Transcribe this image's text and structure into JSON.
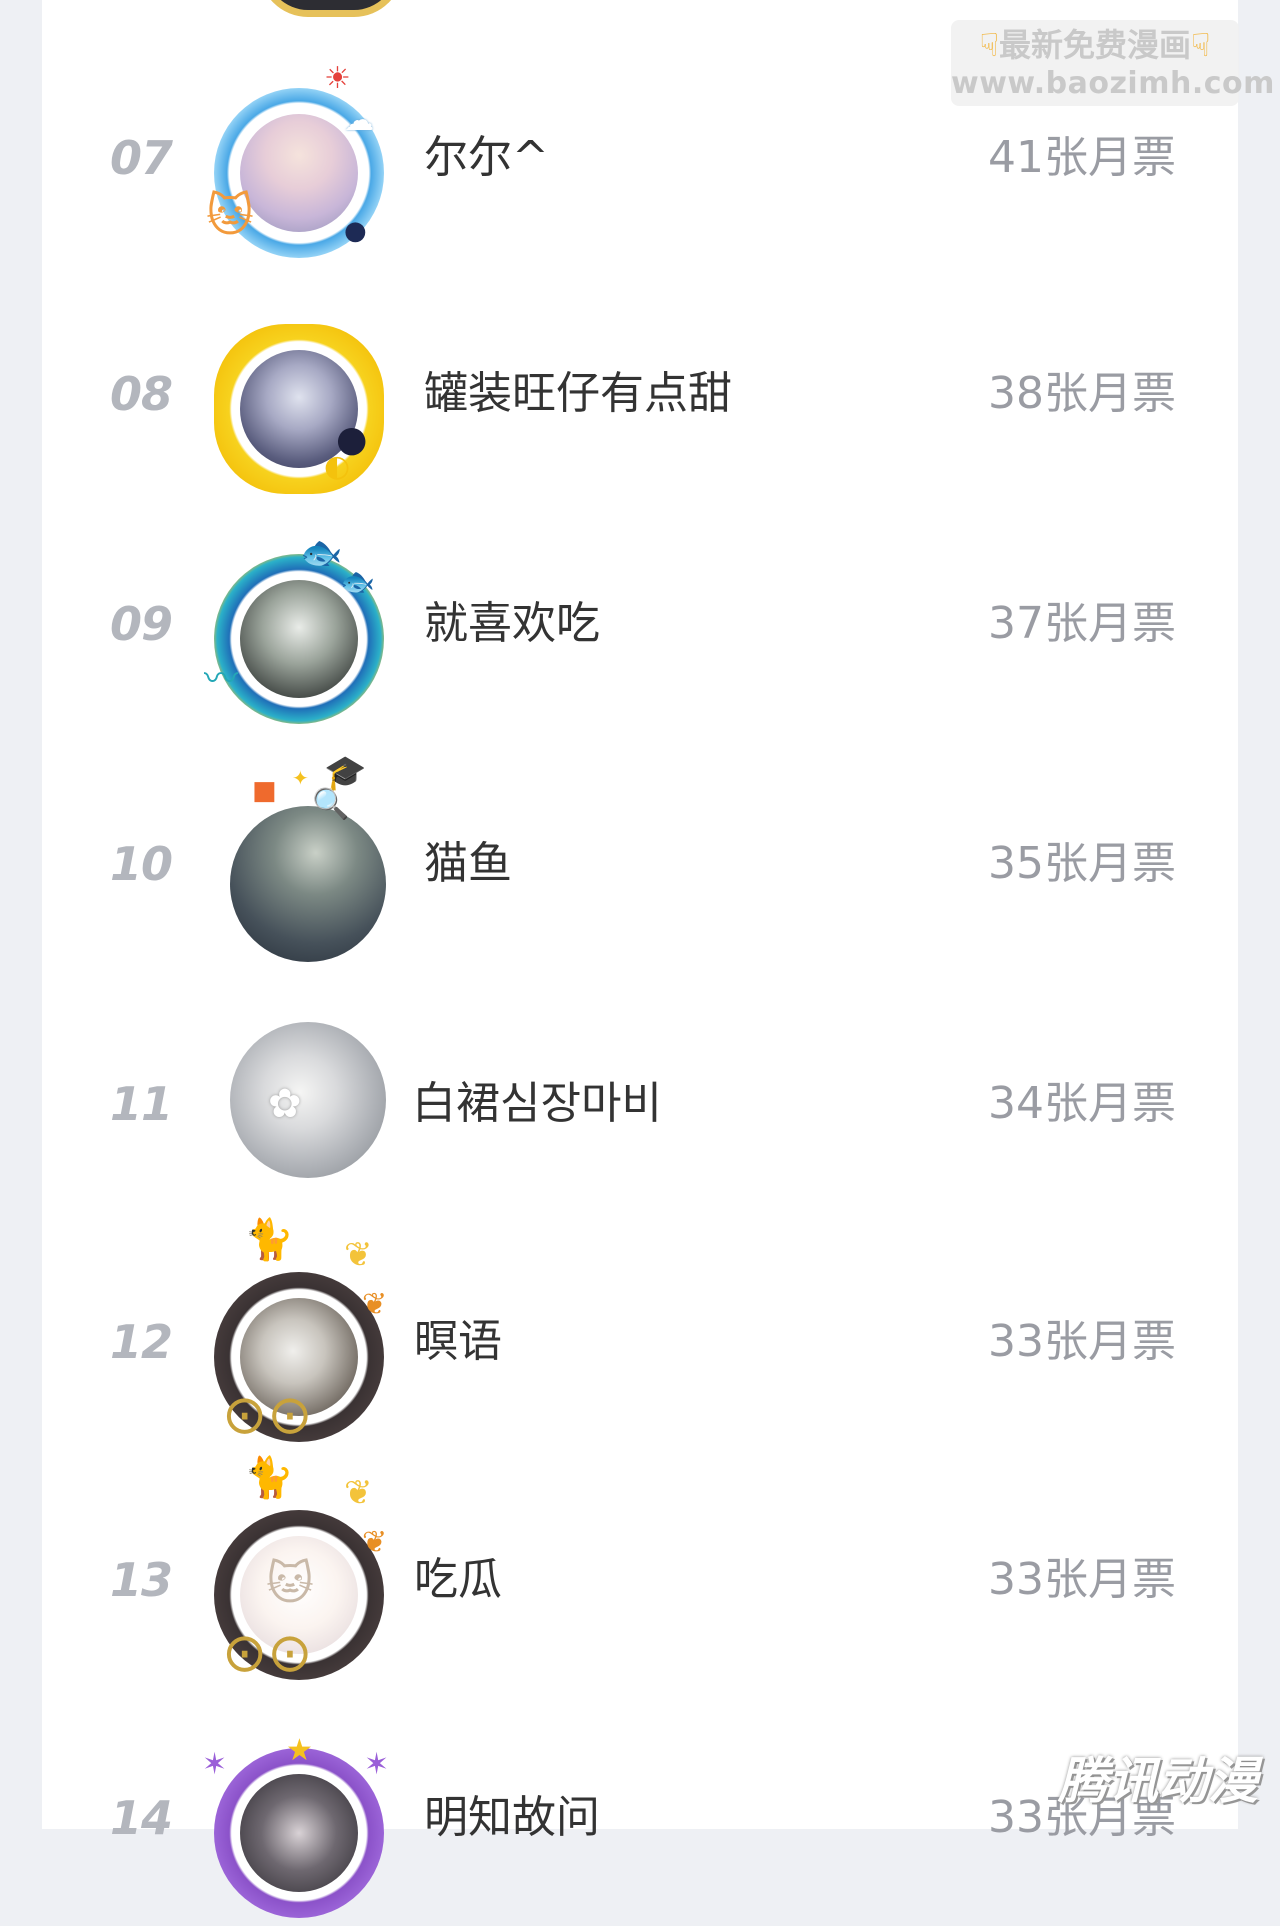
{
  "watermark_top": {
    "line1": "最新免费漫画",
    "line2": "www.baozimh.com",
    "hand_icon": "pointing-down-hand-icon"
  },
  "watermark_bottom": {
    "text": "腾讯动漫"
  },
  "colors": {
    "rank": "#b3b6bd",
    "name": "#333333",
    "tickets": "#9a9ca3",
    "background": "#eef0f4",
    "card": "#ffffff"
  },
  "rows": [
    {
      "rank": "07",
      "name": "尔尔^",
      "tickets": "41张月票",
      "frame": "blue-sky-cloud-frame"
    },
    {
      "rank": "08",
      "name": "罐装旺仔有点甜",
      "tickets": "38张月票",
      "frame": "lemon-frame"
    },
    {
      "rank": "09",
      "name": "就喜欢吃",
      "tickets": "37张月票",
      "frame": "koi-fish-wave-frame"
    },
    {
      "rank": "10",
      "name": "猫鱼",
      "tickets": "35张月票",
      "frame": "graduation-penguin-frame"
    },
    {
      "rank": "11",
      "name": "白裙심장마비",
      "tickets": "34张月票",
      "frame": "none"
    },
    {
      "rank": "12",
      "name": "暝语",
      "tickets": "33张月票",
      "frame": "cat-ginkgo-glasses-frame"
    },
    {
      "rank": "13",
      "name": "吃瓜",
      "tickets": "33张月票",
      "frame": "cat-ginkgo-glasses-frame"
    },
    {
      "rank": "14",
      "name": "明知故问",
      "tickets": "33张月票",
      "frame": "purple-crab-star-frame"
    }
  ]
}
